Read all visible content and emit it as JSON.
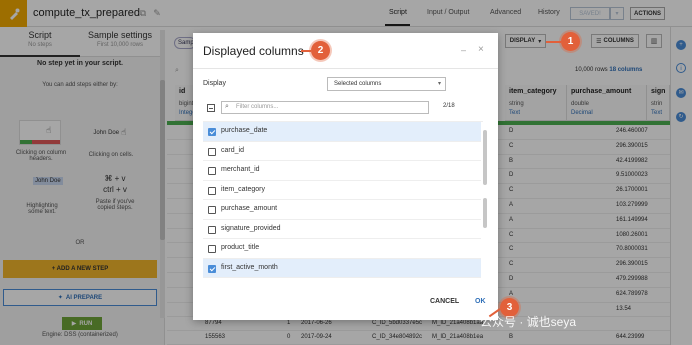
{
  "topbar": {
    "recipe_title": "compute_tx_prepared",
    "nav": [
      "Script",
      "Input / Output",
      "Advanced",
      "History"
    ],
    "saved_label": "SAVED!",
    "actions_label": "ACTIONS"
  },
  "left_panel": {
    "tabs": [
      {
        "title": "Script",
        "sub": "No steps"
      },
      {
        "title": "Sample settings",
        "sub": "First 10,000 rows"
      }
    ],
    "no_step_text": "No step yet in your script.",
    "add_hint": "You can add steps either by:",
    "captions": {
      "column_headers": "Clicking on column headers.",
      "cells": "Clicking on cells.",
      "highlight": "Highlighting some text.",
      "paste": "Paste if you've copied steps."
    },
    "cell_sample": "John Doe",
    "highlight_sample": "John Doe",
    "keys": [
      "⌘ + v",
      "ctrl + v"
    ],
    "or_text": "OR",
    "add_step_label": "+ ADD A NEW STEP",
    "ai_prepare_label": "AI PREPARE",
    "run_label": "RUN",
    "engine_text": "Engine: DSS (containerized)"
  },
  "main": {
    "sample_chip": "Samp",
    "display_btn": "DISPLAY",
    "columns_btn": "COLUMNS",
    "rows_info_prefix": "10,000 rows",
    "rows_info_cols": "18 columns",
    "columns": [
      {
        "name": "id",
        "type": "bigint",
        "meaning": "Integer"
      },
      {
        "name": "item_category",
        "type": "string",
        "meaning": "Text"
      },
      {
        "name": "purchase_amount",
        "type": "double",
        "meaning": "Decimal"
      },
      {
        "name": "sign",
        "type": "strin",
        "meaning": "Text"
      }
    ],
    "rows": [
      {
        "cat": "D",
        "amount": "246.460007"
      },
      {
        "cat": "C",
        "amount": "296.390015"
      },
      {
        "cat": "B",
        "amount": "42.4199982"
      },
      {
        "cat": "D",
        "amount": "9.51000023"
      },
      {
        "cat": "C",
        "amount": "26.1700001"
      },
      {
        "cat": "A",
        "amount": "103.279999"
      },
      {
        "cat": "A",
        "amount": "161.149994"
      },
      {
        "cat": "C",
        "amount": "1080.26001"
      },
      {
        "cat": "C",
        "amount": "70.8000031"
      },
      {
        "cat": "C",
        "amount": "296.390015"
      },
      {
        "cat": "D",
        "amount": "479.299988"
      },
      {
        "cat": "A",
        "amount": "624.789978"
      },
      {
        "cat": "",
        "amount": "13.54"
      }
    ],
    "bottom_rows": [
      {
        "id": "87794",
        "num": "1",
        "date": "2017-06-26",
        "card": "C_ID_5bd0337e5c",
        "merchant": "M_ID_21a408b1aa"
      },
      {
        "id": "155563",
        "num": "0",
        "date": "2017-09-24",
        "card": "C_ID_34e804892c",
        "merchant": "M_ID_21a408b1ea",
        "cat": "B",
        "amount": "644.23999"
      }
    ]
  },
  "modal": {
    "title": "Displayed columns",
    "display_label": "Display",
    "display_value": "Selected columns",
    "filter_placeholder": "Filter columns...",
    "count": "2/18",
    "columns": [
      {
        "name": "purchase_date",
        "checked": true
      },
      {
        "name": "card_id",
        "checked": false
      },
      {
        "name": "merchant_id",
        "checked": false
      },
      {
        "name": "item_category",
        "checked": false
      },
      {
        "name": "purchase_amount",
        "checked": false
      },
      {
        "name": "signature_provided",
        "checked": false
      },
      {
        "name": "product_title",
        "checked": false
      },
      {
        "name": "first_active_month",
        "checked": true
      }
    ],
    "cancel_label": "CANCEL",
    "ok_label": "OK"
  },
  "callouts": [
    "1",
    "2",
    "3"
  ],
  "watermark": "公众号 · 诚也seya",
  "colors": {
    "accent": "#e2603a",
    "brand": "#f2a900",
    "link": "#2f6fb8",
    "valid": "#4caf50"
  }
}
